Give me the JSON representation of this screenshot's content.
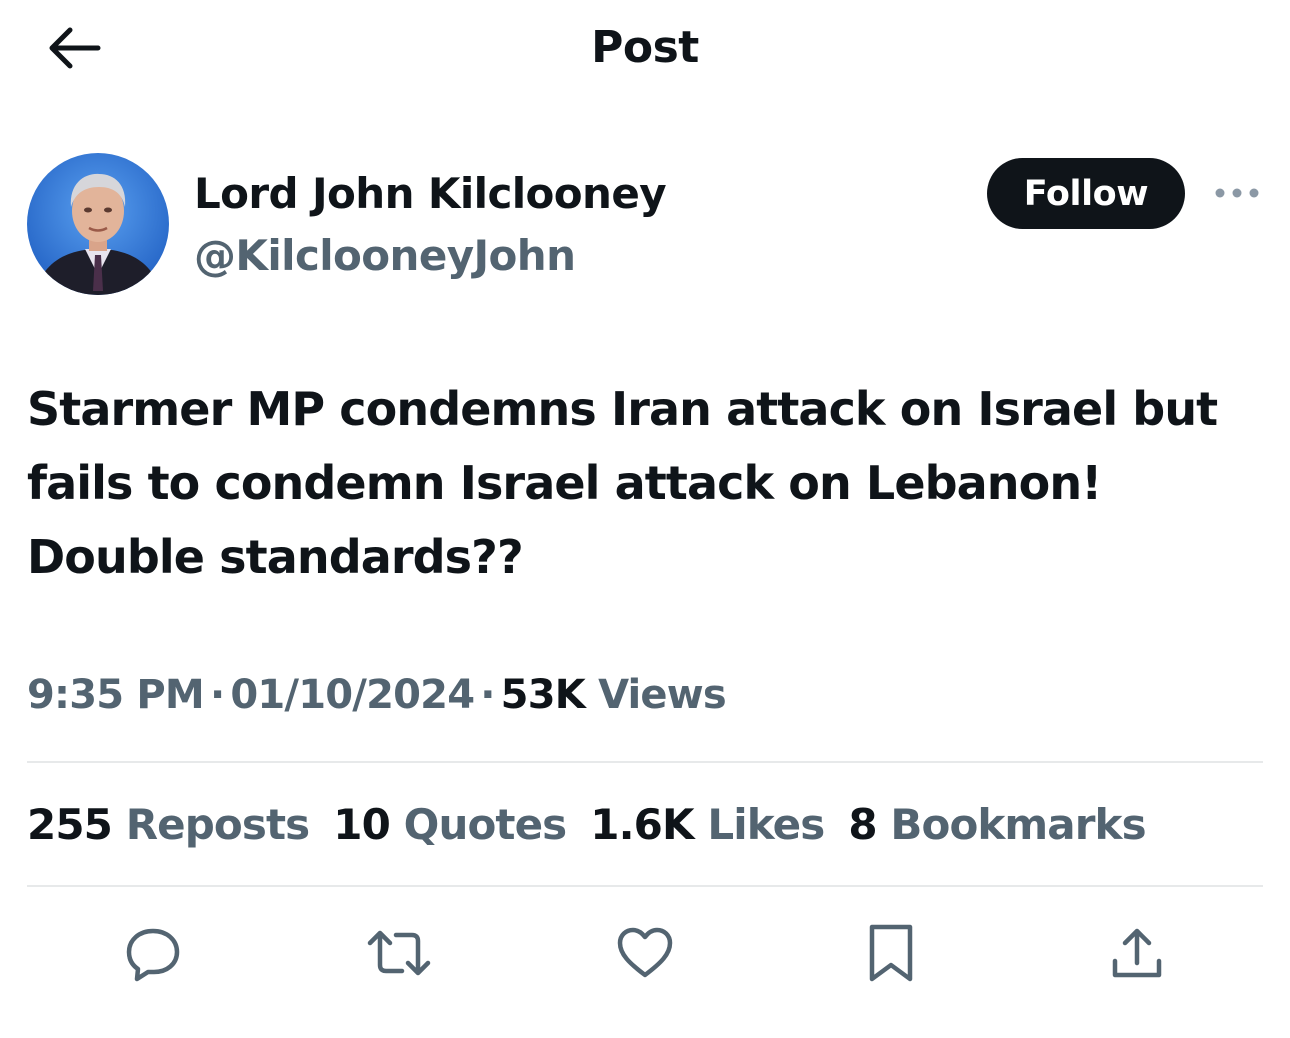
{
  "header": {
    "title": "Post",
    "back_icon": "arrow-left-icon"
  },
  "author": {
    "display_name": "Lord John Kilclooney",
    "handle": "@KilclooneyJohn",
    "follow_label": "Follow",
    "more_icon": "more-horizontal-icon"
  },
  "post": {
    "text": "Starmer MP condemns Iran attack on Israel but\nfails to condemn Israel attack on Lebanon!\nDouble standards??"
  },
  "meta": {
    "time": "9:35 PM",
    "separator": "·",
    "date": "01/10/2024",
    "views_count": "53K",
    "views_label": "Views"
  },
  "stats": {
    "reposts": {
      "count": "255",
      "label": "Reposts"
    },
    "quotes": {
      "count": "10",
      "label": "Quotes"
    },
    "likes": {
      "count": "1.6K",
      "label": "Likes"
    },
    "bookmarks": {
      "count": "8",
      "label": "Bookmarks"
    }
  },
  "actions": [
    "reply-icon",
    "repost-icon",
    "like-icon",
    "bookmark-icon",
    "share-icon"
  ],
  "colors": {
    "text_primary": "#0f1419",
    "text_secondary": "#536471",
    "divider": "#e7e9ea",
    "avatar_background": "#2f74d0"
  }
}
